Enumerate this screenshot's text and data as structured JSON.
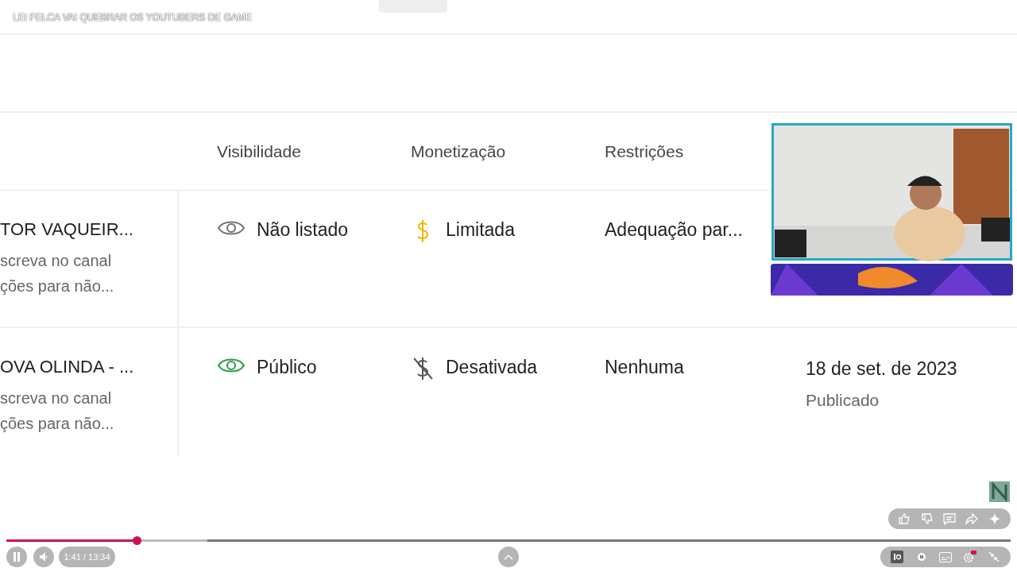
{
  "video_title": "LEI FELCA VAI QUEBRAR OS YOUTUBERS DE GAME",
  "table": {
    "columns": [
      "Visibilidade",
      "Monetização",
      "Restrições"
    ],
    "rows": [
      {
        "title": "TOR VAQUEIR...",
        "description": [
          "screva no canal",
          "ções para não..."
        ],
        "visibility": {
          "kind": "unlisted",
          "label": "Não listado"
        },
        "monetization": {
          "kind": "limited",
          "label": "Limitada"
        },
        "restrictions": "Adequação par..."
      },
      {
        "title": "OVA OLINDA - ...",
        "description": [
          "screva no canal",
          "ções para não..."
        ],
        "visibility": {
          "kind": "public",
          "label": "Público"
        },
        "monetization": {
          "kind": "off",
          "label": "Desativada"
        },
        "restrictions": "Nenhuma",
        "date": "18 de set. de 2023",
        "status": "Publicado"
      }
    ]
  },
  "player": {
    "progress": {
      "level": 0.13
    },
    "time": "1:41 / 13:34"
  }
}
